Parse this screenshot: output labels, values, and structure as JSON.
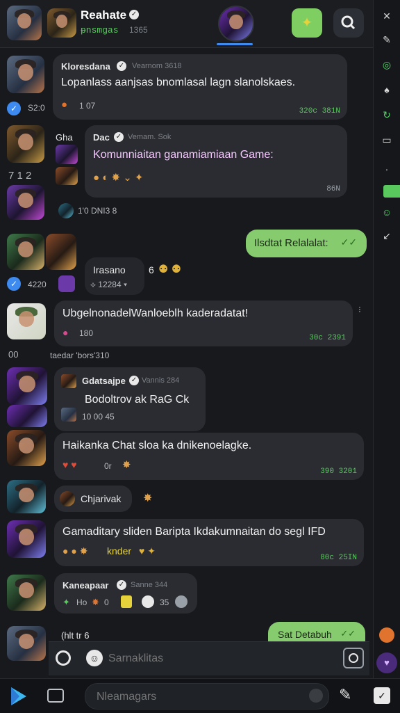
{
  "header": {
    "title": "Reahate",
    "subtitle": "ᵽnsmgas",
    "subcount": "1365"
  },
  "messages": [
    {
      "name": "Kloresdana",
      "meta": "Vearnom 3618",
      "text": "Lopanlass aanjsas bnomlasal lagn slanolskaes.",
      "time": "320c 381N",
      "side_label": "S2:0",
      "reaction": "1 07"
    },
    {
      "name": "Dac",
      "side_name": "Gha",
      "meta": "Vemam. Sok",
      "text": "Komunniaitan ganamiamiaan Game:",
      "time": "86N",
      "side_count": "7 1 2",
      "footer": "1'0 DNI3 8"
    },
    {
      "text": "Ilsdtat Relalalat:",
      "check": "✓✓"
    },
    {
      "name": "Irasano",
      "extra": "6",
      "count": "⟡ 12284 ▾",
      "side_label": "4220"
    },
    {
      "text": "UbgelnonadelWanloeblh kaderadatat!",
      "reaction": "180",
      "time": "30c 2391"
    },
    {
      "left_label": "00",
      "subtext": "taedar 'bors'310"
    },
    {
      "name": "Gdatsajpe",
      "meta": "Vannis 284",
      "text": "Bodoltrov ak RaG Ck",
      "footer": "10 00 45"
    },
    {
      "text": "Haikanka Chat sloa ka dnikenoelagke.",
      "reaction": "0r",
      "time": "390 3201"
    },
    {
      "text": "Chjarivak"
    },
    {
      "text": "Gamaditary sliden Baripta Ikdakumnaitan do segl IFD",
      "reaction": "knder",
      "time": "80c 25IN"
    },
    {
      "name": "Kaneapaar",
      "meta": "Sanne 344",
      "items": [
        "Ho",
        "0",
        "35"
      ]
    },
    {
      "text": "Sat Detabuh",
      "check": "✓✓",
      "partial": "(hlt tr 6"
    }
  ],
  "compose": {
    "placeholder": "Sarnaklitas"
  },
  "dock": {
    "search_placeholder": "Nleamagars"
  },
  "colors": {
    "accent_green": "#86cc6f",
    "time_green": "#59c95e",
    "badge_blue": "#3d8bf0",
    "active_tab": "#3d8bf0"
  },
  "icons": [
    "avatar",
    "verified-icon",
    "gamepad-icon",
    "search-icon",
    "check-icon",
    "emoji-icon",
    "send-icon",
    "mic-icon",
    "play-store-icon",
    "camera-icon"
  ]
}
